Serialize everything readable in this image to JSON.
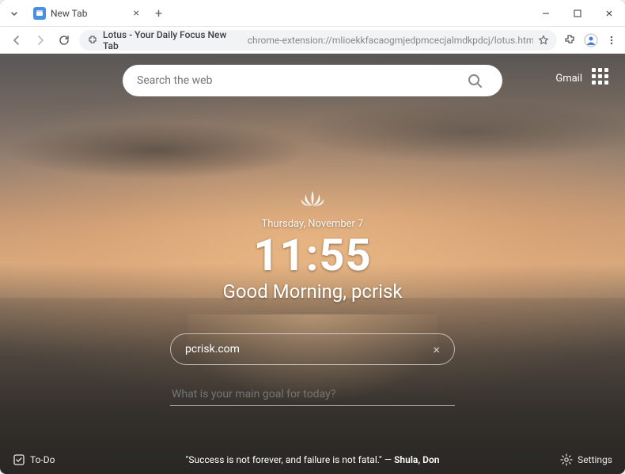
{
  "window": {
    "tab_title": "New Tab"
  },
  "addressbar": {
    "site_title": "Lotus - Your Daily Focus New Tab",
    "url": "chrome-extension://mlioekkfacaogmjedpmcecjalmdkpdcj/lotus.html"
  },
  "top": {
    "search_placeholder": "Search the web",
    "gmail": "Gmail"
  },
  "center": {
    "date": "Thursday, November 7",
    "time": "11:55",
    "greeting": "Good Morning, pcrisk"
  },
  "site_input": {
    "value": "pcrisk.com"
  },
  "goal": {
    "placeholder": "What is your main goal for today?"
  },
  "bottom": {
    "todo": "To-Do",
    "quote_text": "\"Success is not forever, and failure is not fatal.\"",
    "quote_sep": " — ",
    "quote_author": "Shula, Don",
    "settings": "Settings"
  }
}
